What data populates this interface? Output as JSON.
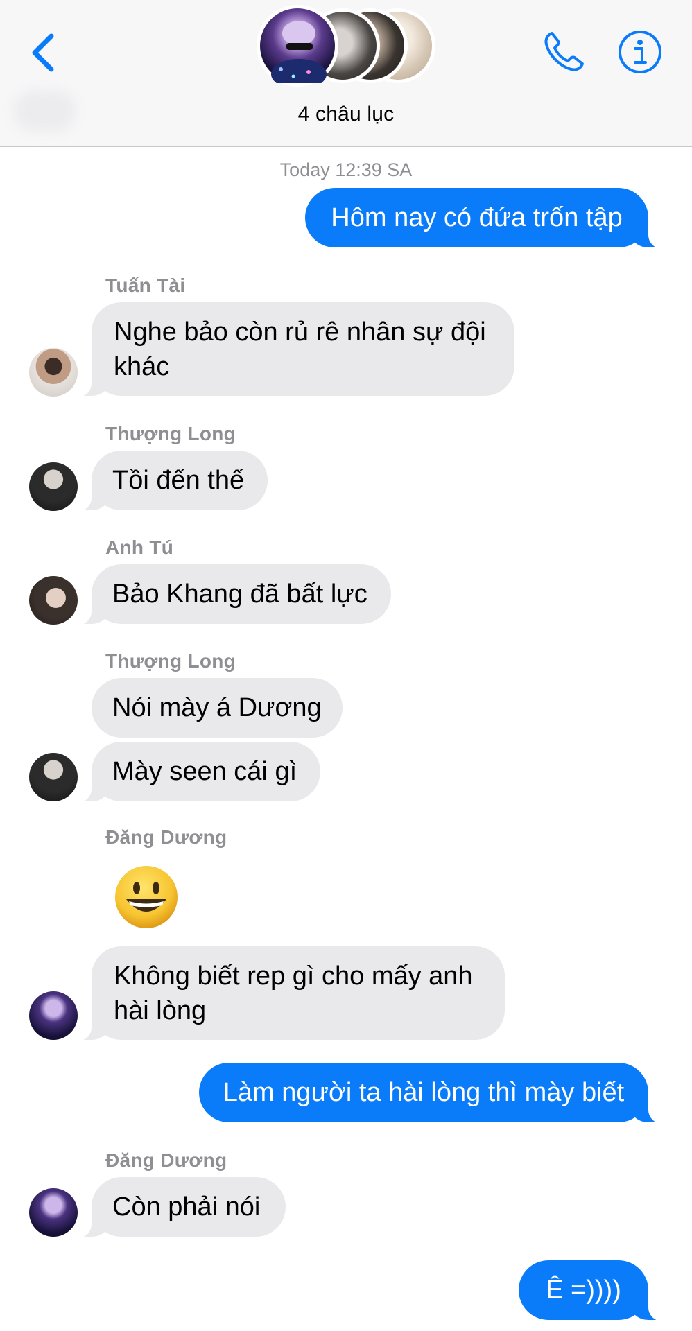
{
  "header": {
    "group_name": "4 châu lục",
    "back_icon": "chevron-left-icon",
    "call_icon": "phone-icon",
    "info_icon": "info-icon",
    "accent": "#0a7cfa"
  },
  "conversation": {
    "timestamp": "Today 12:39 SA",
    "messages": [
      {
        "direction": "outgoing",
        "text": "Hôm nay có đứa trốn tập"
      },
      {
        "direction": "incoming",
        "sender": "Tuấn Tài",
        "text": "Nghe bảo còn rủ rê nhân sự đội khác"
      },
      {
        "direction": "incoming",
        "sender": "Thượng Long",
        "text": "Tồi đến thế"
      },
      {
        "direction": "incoming",
        "sender": "Anh Tú",
        "text": "Bảo Khang đã bất lực"
      },
      {
        "direction": "incoming",
        "sender": "Thượng Long",
        "text": "Nói mày á Dương"
      },
      {
        "direction": "incoming",
        "sender": "Thượng Long",
        "text": "Mày seen cái gì"
      },
      {
        "direction": "incoming",
        "sender": "Đăng Dương",
        "text": "😀"
      },
      {
        "direction": "incoming",
        "sender": "Đăng Dương",
        "text": "Không biết rep gì cho mấy anh hài lòng"
      },
      {
        "direction": "outgoing",
        "text": "Làm người ta hài lòng thì mày biết"
      },
      {
        "direction": "incoming",
        "sender": "Đăng Dương",
        "text": "Còn phải nói"
      },
      {
        "direction": "outgoing",
        "text": "Ê =))))"
      }
    ]
  },
  "colors": {
    "incoming_bubble": "#e9e9eb",
    "outgoing_bubble": "#0a7cfa",
    "sender_name": "#8e8e93"
  }
}
